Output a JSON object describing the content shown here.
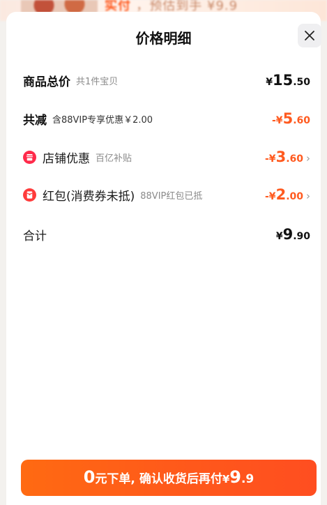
{
  "background_page": {
    "partial_text_prefix": "实付 ",
    "partial_text_suffix": "，预估到手 ¥9.9"
  },
  "sheet": {
    "title": "价格明细",
    "close_icon": "close-icon"
  },
  "rows": {
    "total": {
      "label": "商品总价",
      "sub": "共1件宝贝",
      "prefix": "¥",
      "int": "15",
      "dec": ".50"
    },
    "reduction": {
      "label": "共减",
      "sub": "含88VIP专享优惠￥2.00",
      "prefix": "-¥",
      "int": "5",
      "dec": ".60"
    },
    "store_discount": {
      "icon": "store-icon",
      "label": "店铺优惠",
      "sub": "百亿补贴",
      "prefix": "-¥",
      "int": "3",
      "dec": ".60",
      "chevron": "›"
    },
    "red_packet": {
      "icon": "red-packet-icon",
      "label": "红包(消费券未抵)",
      "sub": "88VIP红包已抵",
      "prefix": "-¥",
      "int": "2",
      "dec": ".00",
      "chevron": "›"
    },
    "sum": {
      "label": "合计",
      "prefix": "¥",
      "int": "9",
      "dec": ".90"
    }
  },
  "cta": {
    "zero": "0",
    "text": "元下单, 确认收货后再付",
    "prefix": "¥",
    "int": "9",
    "dec": ".9"
  },
  "colors": {
    "accent_orange": "#ff5a1f",
    "icon_red": "#ff2a4a",
    "text_primary": "#111111",
    "text_secondary": "#8a8a8a",
    "close_bg": "#efeff1"
  }
}
